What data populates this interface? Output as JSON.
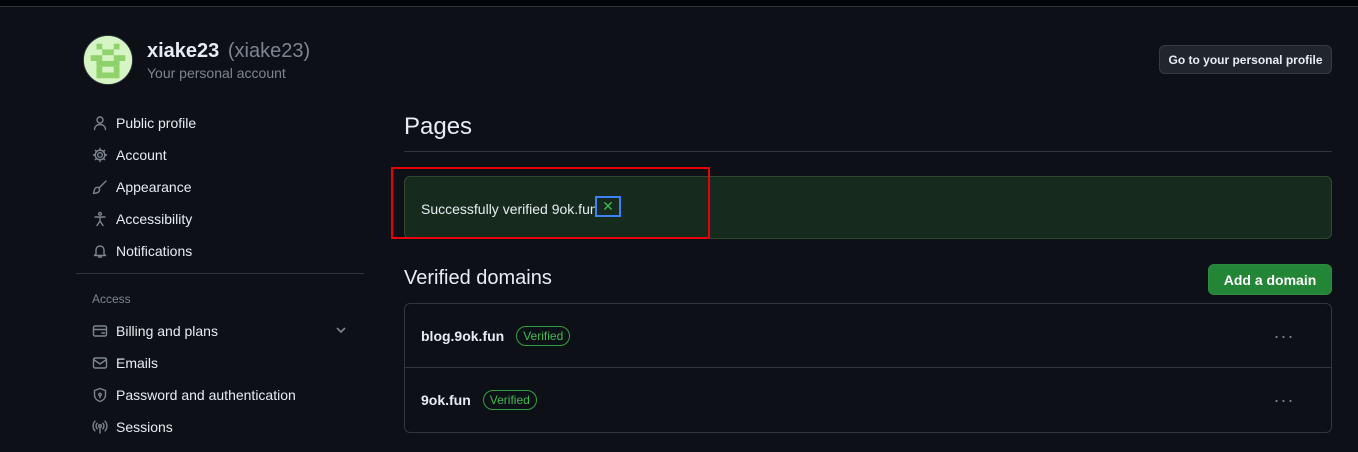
{
  "account": {
    "name": "xiake23",
    "login": "(xiake23)",
    "subtitle": "Your personal account",
    "profile_button": "Go to your personal profile"
  },
  "sidebar": {
    "items": [
      {
        "label": "Public profile",
        "icon": "person-icon"
      },
      {
        "label": "Account",
        "icon": "gear-icon"
      },
      {
        "label": "Appearance",
        "icon": "paintbrush-icon"
      },
      {
        "label": "Accessibility",
        "icon": "accessibility-icon"
      },
      {
        "label": "Notifications",
        "icon": "bell-icon"
      }
    ],
    "access_heading": "Access",
    "access_items": [
      {
        "label": "Billing and plans",
        "icon": "credit-card-icon"
      },
      {
        "label": "Emails",
        "icon": "mail-icon"
      },
      {
        "label": "Password and authentication",
        "icon": "shield-lock-icon"
      },
      {
        "label": "Sessions",
        "icon": "broadcast-icon"
      }
    ]
  },
  "main": {
    "title": "Pages",
    "flash": {
      "message": "Successfully verified 9ok.fun",
      "close_glyph": "✕"
    },
    "verified": {
      "title": "Verified domains",
      "add_button": "Add a domain",
      "rows": [
        {
          "domain": "blog.9ok.fun",
          "badge": "Verified",
          "menu": "···"
        },
        {
          "domain": "9ok.fun",
          "badge": "Verified",
          "menu": "···"
        }
      ]
    }
  },
  "colors": {
    "background": "#0d1117",
    "accent_green": "#238636",
    "verified_green": "#3fb950",
    "annotation_red": "#e5000b",
    "focus_blue": "#3b82f6"
  }
}
